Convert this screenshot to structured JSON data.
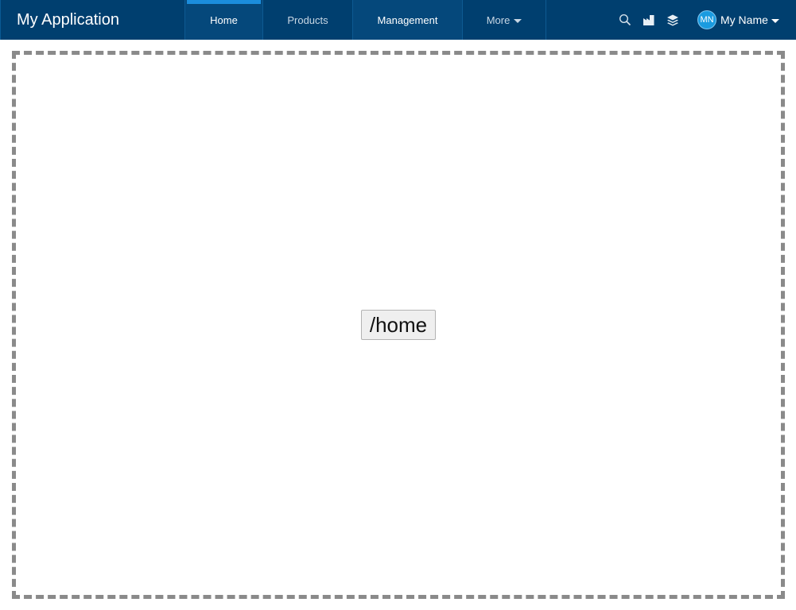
{
  "header": {
    "app_title": "My Application",
    "nav": [
      {
        "label": "Home"
      },
      {
        "label": "Products"
      },
      {
        "label": "Management"
      },
      {
        "label": "More"
      }
    ],
    "tools": [
      "search-icon",
      "factory-icon",
      "layers-icon"
    ],
    "user": {
      "initials": "MN",
      "name": "My Name"
    }
  },
  "main": {
    "route_label": "/home"
  },
  "colors": {
    "header_bg": "#003f6f",
    "active_tab_indicator": "#1b8ddc",
    "avatar_bg": "#1a9be0",
    "frame_border": "#8a8a8a"
  }
}
